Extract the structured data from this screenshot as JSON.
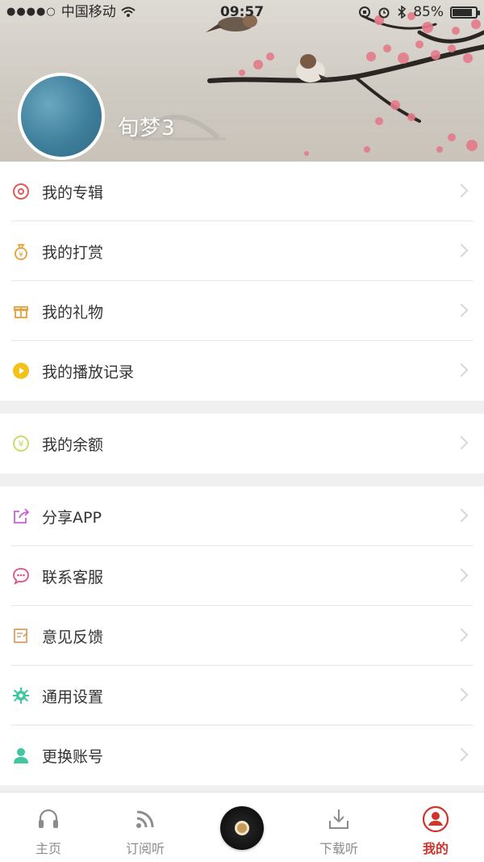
{
  "status_bar": {
    "carrier": "中国移动",
    "time": "09:57",
    "battery": "85%",
    "battery_level": 0.85
  },
  "profile": {
    "username": "旬梦3"
  },
  "menu_groups": [
    {
      "items": [
        {
          "label": "我的专辑",
          "icon": "album-icon",
          "color": "#e05a5a"
        },
        {
          "label": "我的打赏",
          "icon": "money-bag-icon",
          "color": "#e2a23a"
        },
        {
          "label": "我的礼物",
          "icon": "gift-icon",
          "color": "#e2a23a"
        },
        {
          "label": "我的播放记录",
          "icon": "play-history-icon",
          "color": "#f2c21a"
        }
      ]
    },
    {
      "items": [
        {
          "label": "我的余额",
          "icon": "balance-icon",
          "color": "#c7d85a"
        }
      ]
    },
    {
      "items": [
        {
          "label": "分享APP",
          "icon": "share-icon",
          "color": "#c760d6"
        },
        {
          "label": "联系客服",
          "icon": "chat-icon",
          "color": "#e0508a"
        },
        {
          "label": "意见反馈",
          "icon": "feedback-icon",
          "color": "#d8a06a"
        },
        {
          "label": "通用设置",
          "icon": "gear-icon",
          "color": "#3fc8a0"
        },
        {
          "label": "更换账号",
          "icon": "user-icon",
          "color": "#3fc8a0"
        }
      ]
    }
  ],
  "tabbar": {
    "tabs": [
      {
        "label": "主页",
        "icon": "headphones-icon",
        "active": false
      },
      {
        "label": "订阅听",
        "icon": "rss-icon",
        "active": false
      },
      {
        "label": "",
        "icon": "now-playing-disc-icon",
        "active": false
      },
      {
        "label": "下载听",
        "icon": "download-icon",
        "active": false
      },
      {
        "label": "我的",
        "icon": "profile-icon",
        "active": true
      }
    ],
    "active_color": "#d0342c",
    "inactive_color": "#8c8c8c"
  }
}
